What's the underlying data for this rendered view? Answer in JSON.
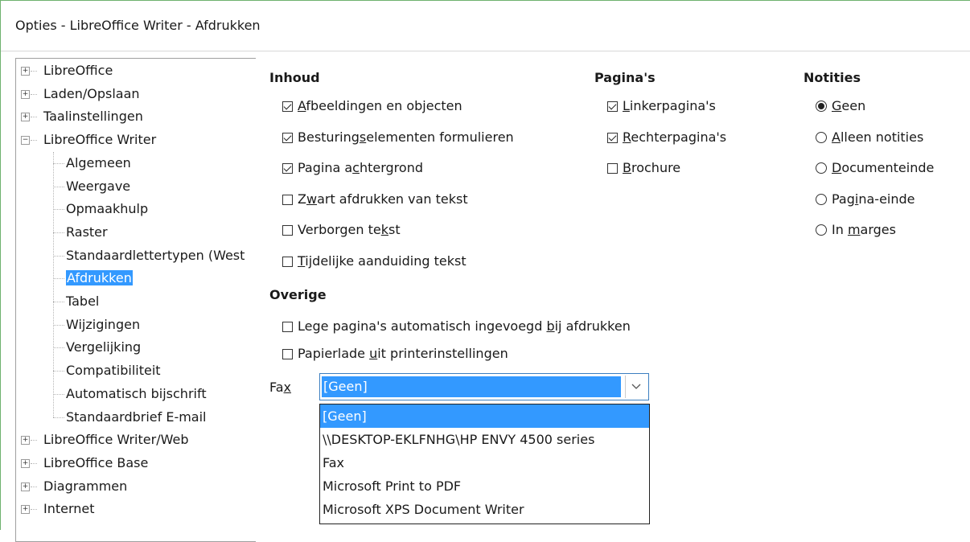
{
  "window": {
    "title": "Opties - LibreOffice Writer - Afdrukken"
  },
  "tree": {
    "top_items": [
      {
        "label": "LibreOffice",
        "expander": "+"
      },
      {
        "label": "Laden/Opslaan",
        "expander": "+"
      },
      {
        "label": "Taalinstellingen",
        "expander": "+"
      },
      {
        "label": "LibreOffice Writer",
        "expander": "−"
      }
    ],
    "writer_children": [
      "Algemeen",
      "Weergave",
      "Opmaakhulp",
      "Raster",
      "Standaardlettertypen (West",
      "Afdrukken",
      "Tabel",
      "Wijzigingen",
      "Vergelijking",
      "Compatibiliteit",
      "Automatisch bijschrift",
      "Standaardbrief E-mail"
    ],
    "selected": "Afdrukken",
    "bottom_items": [
      {
        "label": "LibreOffice Writer/Web",
        "expander": "+"
      },
      {
        "label": "LibreOffice Base",
        "expander": "+"
      },
      {
        "label": "Diagrammen",
        "expander": "+"
      },
      {
        "label": "Internet",
        "expander": "+"
      }
    ]
  },
  "inhoud": {
    "heading": "Inhoud",
    "options": [
      {
        "pre": "",
        "u": "A",
        "post": "fbeeldingen en objecten",
        "checked": true
      },
      {
        "pre": "Besturing",
        "u": "s",
        "post": "elementen formulieren",
        "checked": true
      },
      {
        "pre": "Pagina a",
        "u": "c",
        "post": "htergrond",
        "checked": true
      },
      {
        "pre": "Z",
        "u": "w",
        "post": "art afdrukken van tekst",
        "checked": false
      },
      {
        "pre": "Verborgen te",
        "u": "k",
        "post": "st",
        "checked": false
      },
      {
        "pre": "",
        "u": "T",
        "post": "ijdelijke aanduiding tekst",
        "checked": false
      }
    ]
  },
  "paginas": {
    "heading": "Pagina's",
    "options": [
      {
        "pre": "",
        "u": "L",
        "post": "inkerpagina's",
        "checked": true
      },
      {
        "pre": "",
        "u": "R",
        "post": "echterpagina's",
        "checked": true
      },
      {
        "pre": "",
        "u": "B",
        "post": "rochure",
        "checked": false
      }
    ]
  },
  "notities": {
    "heading": "Notities",
    "options": [
      {
        "pre": "",
        "u": "G",
        "post": "een",
        "checked": true
      },
      {
        "pre": "",
        "u": "A",
        "post": "lleen notities",
        "checked": false
      },
      {
        "pre": "",
        "u": "D",
        "post": "ocumenteinde",
        "checked": false
      },
      {
        "pre": "Pag",
        "u": "i",
        "post": "na-einde",
        "checked": false
      },
      {
        "pre": "In ",
        "u": "m",
        "post": "arges",
        "checked": false
      }
    ]
  },
  "overige": {
    "heading": "Overige",
    "options": [
      {
        "pre": "Lege pagina's automatisch ingevoegd ",
        "u": "b",
        "post": "ij afdrukken",
        "checked": false
      },
      {
        "pre": "Papierlade ",
        "u": "u",
        "post": "it printerinstellingen",
        "checked": false
      }
    ]
  },
  "fax": {
    "label_pre": "Fa",
    "label_u": "x",
    "selected": "[Geen]",
    "options": [
      "[Geen]",
      "\\\\DESKTOP-EKLFNHG\\HP ENVY 4500 series",
      "Fax",
      "Microsoft Print to PDF",
      "Microsoft XPS Document Writer"
    ]
  }
}
